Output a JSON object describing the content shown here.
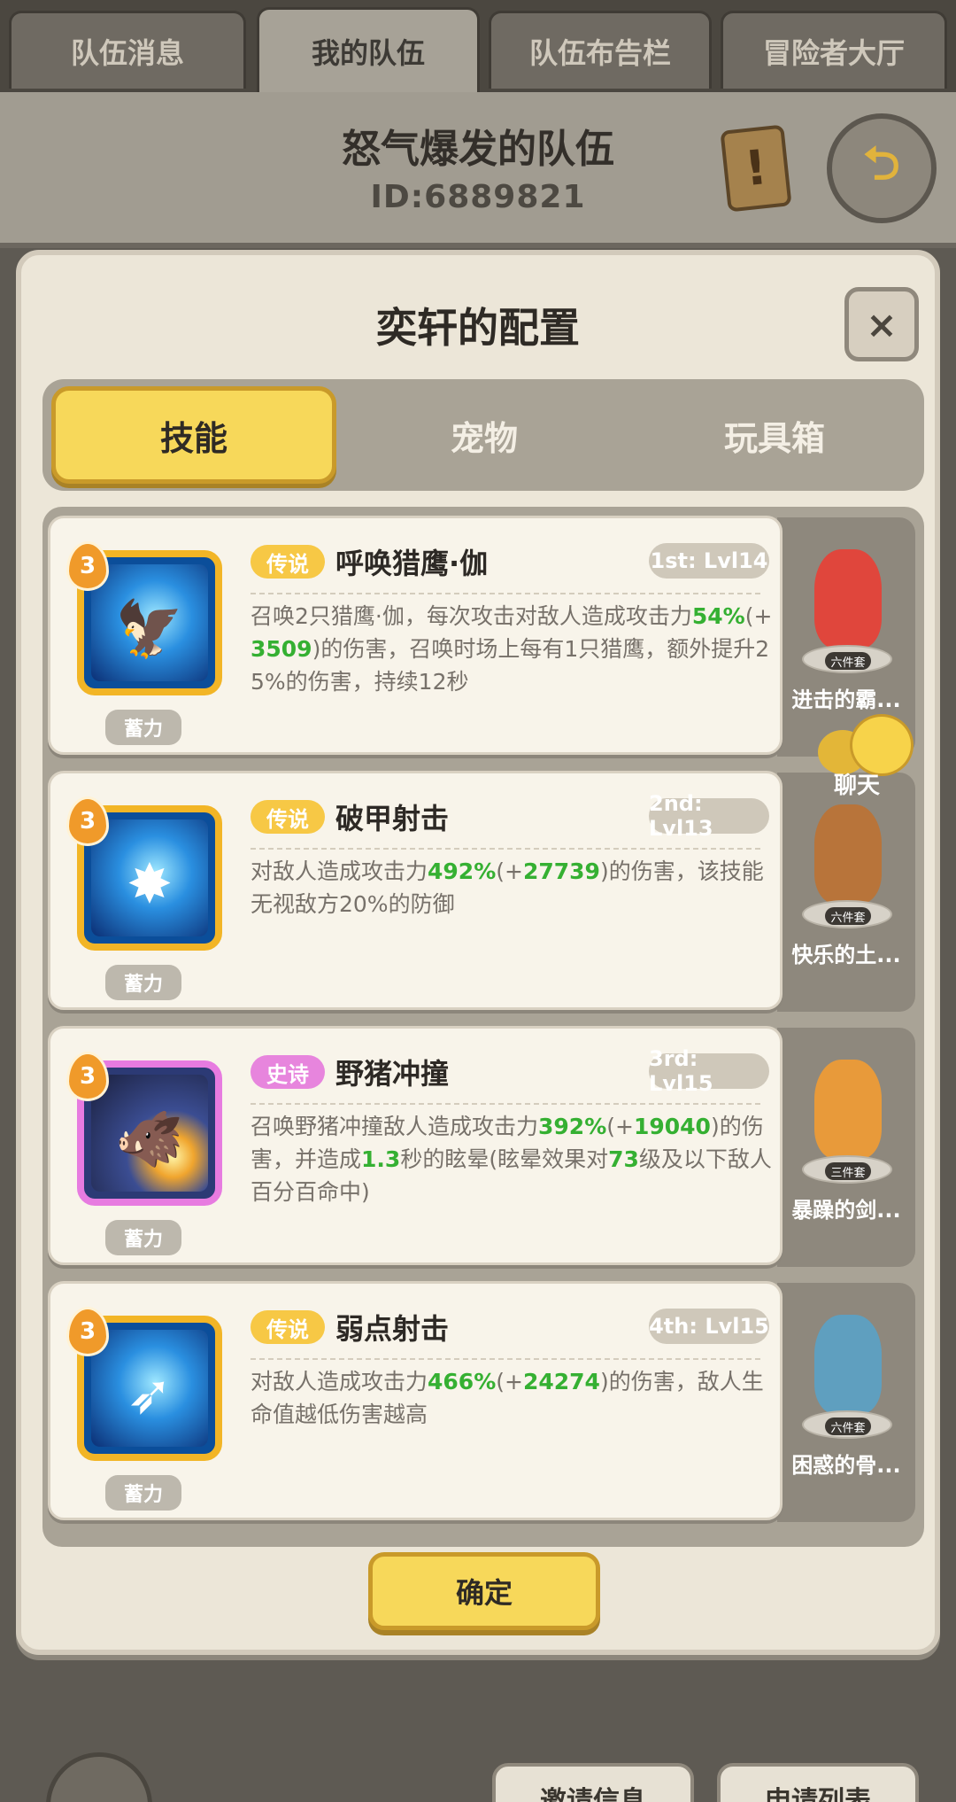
{
  "top_tabs": [
    "队伍消息",
    "我的队伍",
    "队伍布告栏",
    "冒险者大厅"
  ],
  "team": {
    "name": "怒气爆发的队伍",
    "id": "ID:6889821"
  },
  "modal": {
    "title": "奕轩的配置",
    "close": "×",
    "tabs": [
      "技能",
      "宠物",
      "玩具箱"
    ],
    "confirm": "确定"
  },
  "skills": [
    {
      "level": "3",
      "rarity": "传说",
      "name": "呼唤猎鹰·伽",
      "slot": "1st: Lvl14",
      "tag": "蓄力",
      "desc": [
        "召唤2只猎鹰·伽，每次攻击对敌人造成攻击力",
        "54%",
        "(+",
        "3509",
        ")的伤害，召唤时场上每有1只猎鹰，额外提升25%的伤害，持续12秒"
      ]
    },
    {
      "level": "3",
      "rarity": "传说",
      "name": "破甲射击",
      "slot": "2nd: Lvl13",
      "tag": "蓄力",
      "desc": [
        "对敌人造成攻击力",
        "492%",
        "(+",
        "27739",
        ")的伤害，该技能无视敌方20%的防御"
      ]
    },
    {
      "level": "3",
      "rarity": "史诗",
      "name": "野猪冲撞",
      "slot": "3rd: Lvl15",
      "tag": "蓄力",
      "desc": [
        "召唤野猪冲撞敌人造成攻击力",
        "392%",
        "(+",
        "19040",
        ")的伤害，并造成",
        "1.3",
        "秒的眩晕(眩晕效果对",
        "73",
        "级及以下敌人百分百命中)"
      ]
    },
    {
      "level": "3",
      "rarity": "传说",
      "name": "弱点射击",
      "slot": "4th: Lvl15",
      "tag": "蓄力",
      "desc": [
        "对敌人造成攻击力",
        "466%",
        "(+",
        "24274",
        ")的伤害，敌人生命值越低伤害越高"
      ]
    }
  ],
  "companions": [
    {
      "name": "进击的霸...",
      "set": "六件套",
      "color": "#e0463c"
    },
    {
      "name": "快乐的土...",
      "set": "六件套",
      "color": "#b8743a"
    },
    {
      "name": "暴躁的剑...",
      "set": "三件套",
      "color": "#e89a3a"
    },
    {
      "name": "困惑的骨...",
      "set": "六件套",
      "color": "#5f9fbf"
    }
  ],
  "chat": "聊天",
  "bottom_buttons": [
    "邀请信息",
    "申请列表"
  ]
}
